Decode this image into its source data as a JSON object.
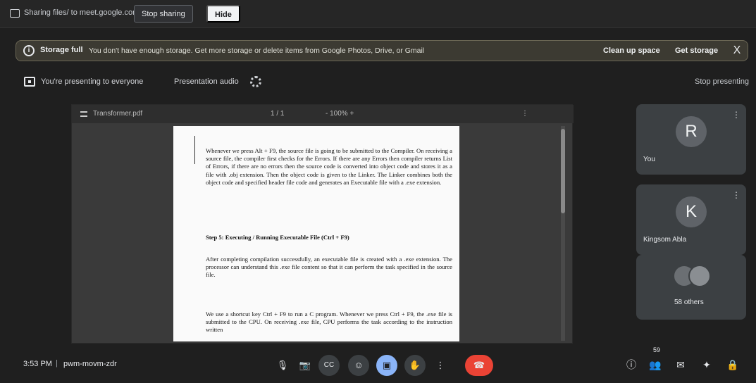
{
  "share_bar": {
    "text": "Sharing files/ to meet.google.com",
    "stop_label": "Stop sharing",
    "hide_label": "Hide"
  },
  "storage_banner": {
    "title": "Storage full",
    "message": "You don't have enough storage. Get more storage or delete items from Google Photos, Drive, or Gmail",
    "clean_up": "Clean up space",
    "get_storage": "Get storage",
    "close": "X"
  },
  "presenting": {
    "text": "You're presenting to everyone",
    "audio": "Presentation audio",
    "stop": "Stop presenting"
  },
  "viewer": {
    "file": "Transformer.pdf",
    "page": "1 / 1",
    "zoom": "- 100% +",
    "tools": "⋮"
  },
  "document": {
    "p1": "Whenever we press Alt + F9, the source file is going to be submitted to the Compiler. On receiving a source file, the compiler first checks for the Errors. If there are any Errors then compiler returns List of Errors, if there are no errors then the source code is converted into object code and stores it as a file with .obj extension. Then the object code is given to the Linker. The Linker combines both the object code and specified header file code and generates an Executable file with a .exe extension.",
    "p2": "Step 5: Executing / Running Executable File (Ctrl + F9)",
    "p3": "After completing compilation successfully, an executable file is created with a .exe extension. The processor can understand this .exe file content so that it can perform the task specified in the source file.",
    "p4": "We use a shortcut key Ctrl + F9 to run a C program. Whenever we press Ctrl + F9, the .exe file is submitted to the CPU. On receiving .exe file, CPU performs the task according to the instruction written"
  },
  "participants": [
    {
      "initial": "R",
      "name": "You"
    },
    {
      "initial": "K",
      "name": "Kingsom Abla"
    }
  ],
  "others": {
    "label": "58 others"
  },
  "bottom": {
    "time": "3:53 PM",
    "divider": "|",
    "code": "pwm-movm-zdr",
    "participant_count": "59"
  },
  "icons": {
    "more": "⋮",
    "mic": "🎙",
    "cam": "📷",
    "captions": "CC",
    "emoji": "☺",
    "present": "▣",
    "hand": "✋",
    "more_ctrl": "⋮",
    "hangup": "☎",
    "info": "ⓘ",
    "people": "👥",
    "chat": "✉",
    "activities": "✦",
    "lock": "🔒"
  },
  "colors": {
    "accent": "#8ab4f8",
    "danger": "#ea4335",
    "banner_bg": "#3c3a32"
  }
}
